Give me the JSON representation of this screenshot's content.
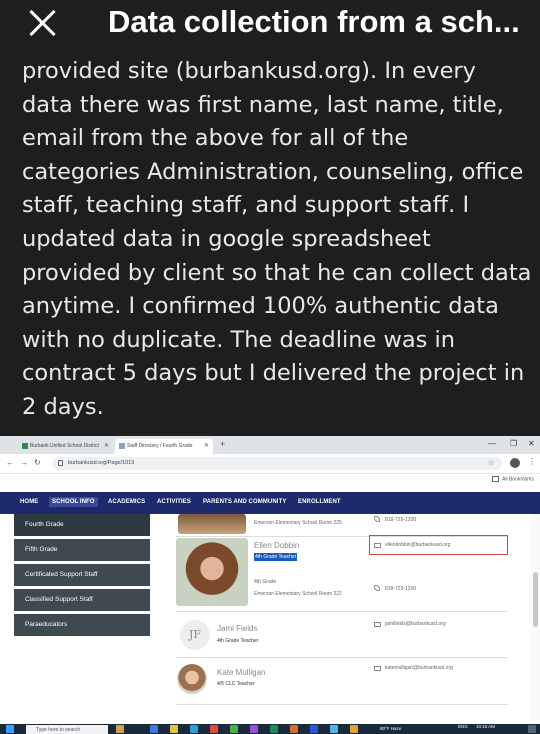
{
  "modal": {
    "title": "Data collection from a sch...",
    "description": "provided site (burbankusd.org). In every data there was first name, last name, title, email from the above for all of the categories Administration, counseling, office staff, teaching staff, and support staff. I updated data in google spreadsheet provided by client so that he can collect data anytime. I confirmed 100% authentic data with no duplicate. The deadline was in contract 5 days but I delivered the project in 2 days."
  },
  "browser": {
    "tabs": [
      {
        "label": "Burbank Unified School District"
      },
      {
        "label": "Staff Directory / Fourth Grade"
      }
    ],
    "url": "burbankusd.org/Page/1013",
    "all_bookmarks": "All Bookmarks"
  },
  "site_nav": [
    "HOME",
    "SCHOOL INFO",
    "ACADEMICS",
    "ACTIVITIES",
    "PARENTS AND COMMUNITY",
    "ENROLLMENT"
  ],
  "sidebar": [
    "Fourth Grade",
    "Fifth Grade",
    "Certificated Support Staff",
    "Classified Support Staff",
    "Paraeducators"
  ],
  "staff": [
    {
      "location": "Emerson Elementary School Room 225",
      "phone": "818-729-1200"
    },
    {
      "name": "Ellen Dobbin",
      "title": "4th Grade Teacher",
      "department": "4th Grade",
      "location": "Emerson Elementary School Room 222",
      "email": "ellendobbin@burbankusd.org",
      "phone": "818-729-1200"
    },
    {
      "initials": "JF",
      "name": "Jami Fields",
      "title": "4th Grade Teacher",
      "email": "jamifields@burbankusd.org"
    },
    {
      "name": "Kate Mulligan",
      "title": "4/5 CLC Teacher",
      "email": "katemulligan@burbankusd.org"
    }
  ],
  "taskbar": {
    "search_placeholder": "Type here to search",
    "weather": "80°F Haze",
    "time": "10:15 AM",
    "lang": "ENG"
  }
}
